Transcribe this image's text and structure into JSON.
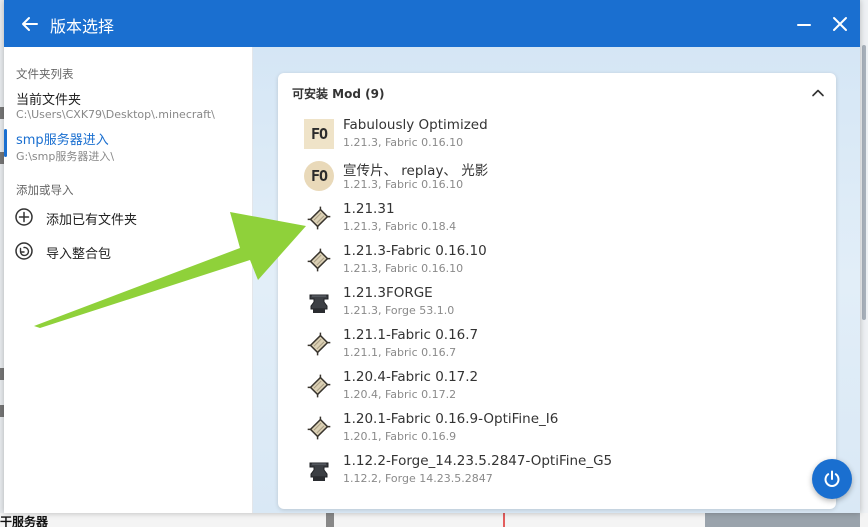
{
  "window": {
    "title": "版本选择"
  },
  "sidebar": {
    "folder_section_label": "文件夹列表",
    "folders": [
      {
        "name": "当前文件夹",
        "path": "C:\\Users\\CXK79\\Desktop\\.minecraft\\"
      },
      {
        "name": "smp服务器进入",
        "path": "G:\\smp服务器进入\\"
      }
    ],
    "action_section_label": "添加或导入",
    "actions": [
      {
        "label": "添加已有文件夹",
        "icon": "add-circle-icon"
      },
      {
        "label": "导入整合包",
        "icon": "import-modpack-icon"
      }
    ]
  },
  "main": {
    "section_title": "可安装 Mod (9)",
    "versions": [
      {
        "name": "Fabulously Optimized",
        "sub": "1.21.3, Fabric 0.16.10",
        "icon": "fo-square-icon"
      },
      {
        "name": "宣传片、 replay、 光影",
        "sub": "1.21.3, Fabric 0.16.10",
        "icon": "fo-round-icon"
      },
      {
        "name": "1.21.31",
        "sub": "1.21.3, Fabric 0.18.4",
        "icon": "fabric-icon"
      },
      {
        "name": "1.21.3-Fabric 0.16.10",
        "sub": "1.21.3, Fabric 0.16.10",
        "icon": "fabric-icon"
      },
      {
        "name": "1.21.3FORGE",
        "sub": "1.21.3, Forge 53.1.0",
        "icon": "forge-anvil-icon"
      },
      {
        "name": "1.21.1-Fabric 0.16.7",
        "sub": "1.21.1, Fabric 0.16.7",
        "icon": "fabric-icon"
      },
      {
        "name": "1.20.4-Fabric 0.17.2",
        "sub": "1.20.4, Fabric 0.17.2",
        "icon": "fabric-icon"
      },
      {
        "name": "1.20.1-Fabric 0.16.9-OptiFine_I6",
        "sub": "1.20.1, Fabric 0.16.9",
        "icon": "fabric-icon"
      },
      {
        "name": "1.12.2-Forge_14.23.5.2847-OptiFine_G5",
        "sub": "1.12.2, Forge 14.23.5.2847",
        "icon": "forge-anvil-icon"
      }
    ]
  },
  "background": {
    "bottom_text": "干服务器"
  },
  "colors": {
    "accent": "#1a6fd0",
    "arrow": "#8fd13a"
  }
}
